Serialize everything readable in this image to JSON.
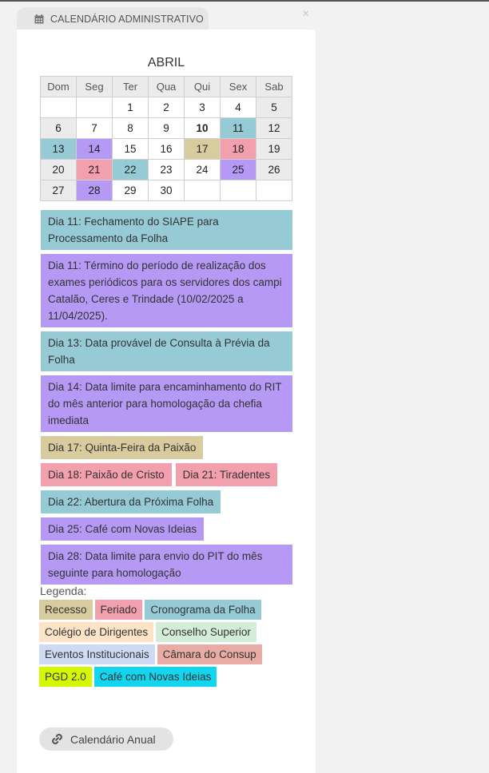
{
  "header": {
    "tab_title": "CALENDÁRIO ADMINISTRATIVO",
    "close_symbol": "×"
  },
  "calendar": {
    "month": "ABRIL",
    "weekdays": [
      "Dom",
      "Seg",
      "Ter",
      "Qua",
      "Qui",
      "Sex",
      "Sab"
    ],
    "today": "10",
    "weeks": [
      [
        "",
        "",
        "1",
        "2",
        "3",
        "4",
        "5"
      ],
      [
        "6",
        "7",
        "8",
        "9",
        "10",
        "11",
        "12"
      ],
      [
        "13",
        "14",
        "15",
        "16",
        "17",
        "18",
        "19"
      ],
      [
        "20",
        "21",
        "22",
        "23",
        "24",
        "25",
        "26"
      ],
      [
        "27",
        "28",
        "29",
        "30",
        "",
        "",
        ""
      ]
    ]
  },
  "events": [
    "Dia 11: Fechamento do SIAPE para Processamento da Folha",
    "Dia 11: Término do período de realização dos exames periódicos para os servidores dos campi Catalão, Ceres e Trindade (10/02/2025 a 11/04/2025).",
    "Dia 13: Data provável de Consulta à Prévia da Folha",
    "Dia 14: Data limite para encaminhamento do RIT do mês anterior para homologação da chefia imediata",
    "Dia 17: Quinta-Feira da Paixão",
    "Dia 18: Paixão de Cristo",
    "Dia 21: Tiradentes",
    "Dia 22: Abertura da Próxima Folha",
    "Dia 25: Café com Novas Ideias",
    "Dia 28: Data limite para envio do PIT do mês seguinte para homologação"
  ],
  "legend": {
    "title": "Legenda:",
    "items": [
      {
        "label": "Recesso",
        "color": "#d8cb9d"
      },
      {
        "label": "Feriado",
        "color": "#f2a0ad"
      },
      {
        "label": "Cronograma da Folha",
        "color": "#96cbd6"
      },
      {
        "label": "Colégio de Dirigentes",
        "color": "#fde4c6"
      },
      {
        "label": "Conselho Superior",
        "color": "#d4edd8"
      },
      {
        "label": "Eventos Institucionais",
        "color": "#cfdaf5"
      },
      {
        "label": "Câmara do Consup",
        "color": "#e8aca4"
      },
      {
        "label": "PGD 2.0",
        "color": "#d5f700"
      },
      {
        "label": "Café com Novas Ideias",
        "color": "#13d6ee"
      }
    ]
  },
  "colors": {
    "folha": "#96cbd6",
    "evento": "#b699f5",
    "feriado": "#f2a0ad",
    "recesso": "#d8cb9d"
  },
  "footer": {
    "annual_button_label": "Calendário Anual"
  }
}
